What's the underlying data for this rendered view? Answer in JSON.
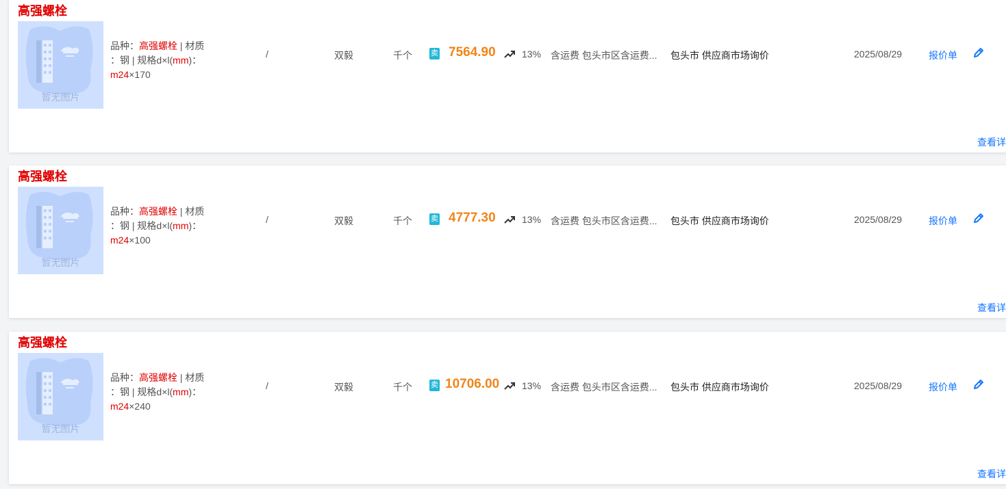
{
  "placeholder_image_text": "暂无图片",
  "items": [
    {
      "title": "高强螺栓",
      "spec_variety_label": "品种：",
      "spec_variety": "高强螺栓",
      "spec_sep1": " | 材质",
      "spec_line2": "：钢 | 规格d×l(",
      "spec_mm": "mm",
      "spec_line2_end": ")：",
      "spec_size_prefix": "m24",
      "spec_size_rest": "×170",
      "slash": "/",
      "brand": "双毅",
      "unit": "千个",
      "sell_badge": "卖",
      "price": "7564.90",
      "tax": "13%",
      "shipping": "含运费 包头市区含运费...",
      "city_source": "包头市 供应商市场询价",
      "date": "2025/08/29",
      "quote_label": "报价单",
      "detail_label": "查看详"
    },
    {
      "title": "高强螺栓",
      "spec_variety_label": "品种：",
      "spec_variety": "高强螺栓",
      "spec_sep1": " | 材质",
      "spec_line2": "：钢 | 规格d×l(",
      "spec_mm": "mm",
      "spec_line2_end": ")：",
      "spec_size_prefix": "m24",
      "spec_size_rest": "×100",
      "slash": "/",
      "brand": "双毅",
      "unit": "千个",
      "sell_badge": "卖",
      "price": "4777.30",
      "tax": "13%",
      "shipping": "含运费 包头市区含运费...",
      "city_source": "包头市 供应商市场询价",
      "date": "2025/08/29",
      "quote_label": "报价单",
      "detail_label": "查看详"
    },
    {
      "title": "高强螺栓",
      "spec_variety_label": "品种：",
      "spec_variety": "高强螺栓",
      "spec_sep1": " | 材质",
      "spec_line2": "：钢 | 规格d×l(",
      "spec_mm": "mm",
      "spec_line2_end": ")：",
      "spec_size_prefix": "m24",
      "spec_size_rest": "×240",
      "slash": "/",
      "brand": "双毅",
      "unit": "千个",
      "sell_badge": "卖",
      "price": "10706.00",
      "tax": "13%",
      "shipping": "含运费 包头市区含运费...",
      "city_source": "包头市 供应商市场询价",
      "date": "2025/08/29",
      "quote_label": "报价单",
      "detail_label": "查看详"
    }
  ],
  "colors": {
    "title_red": "#e00000",
    "price_orange": "#f08519",
    "link_blue": "#1677ff",
    "badge_teal": "#21b8d8"
  },
  "icons": {
    "trend": "trend-up-icon",
    "edit": "pencil-edit-icon",
    "placeholder": "image-placeholder-icon"
  }
}
